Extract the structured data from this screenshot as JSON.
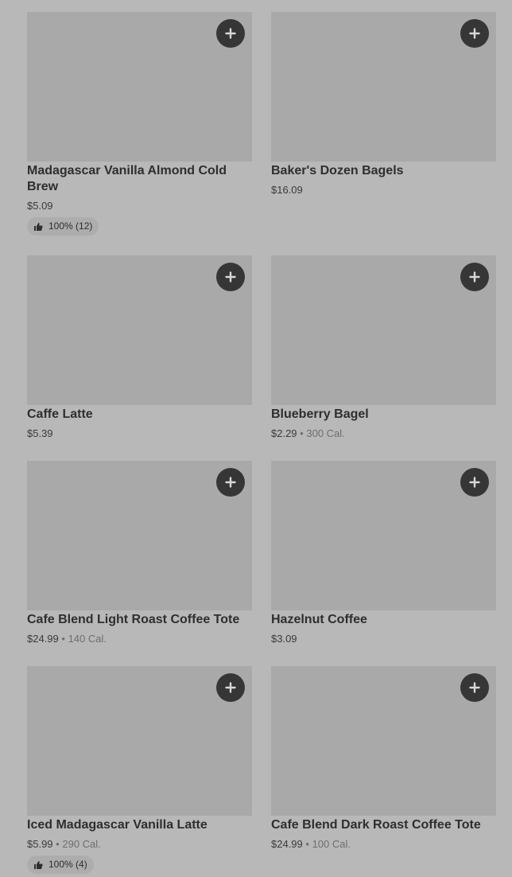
{
  "products": [
    {
      "name": "Madagascar Vanilla Almond Cold Brew",
      "price": "$5.09",
      "calories": "",
      "rating": "100% (12)"
    },
    {
      "name": "Baker's Dozen Bagels",
      "price": "$16.09",
      "calories": "",
      "rating": ""
    },
    {
      "name": "Caffe Latte",
      "price": "$5.39",
      "calories": "",
      "rating": ""
    },
    {
      "name": "Blueberry Bagel",
      "price": "$2.29",
      "calories": "300 Cal.",
      "rating": ""
    },
    {
      "name": "Cafe Blend Light Roast Coffee Tote",
      "price": "$24.99",
      "calories": "140 Cal.",
      "rating": ""
    },
    {
      "name": "Hazelnut Coffee",
      "price": "$3.09",
      "calories": "",
      "rating": ""
    },
    {
      "name": "Iced Madagascar Vanilla Latte",
      "price": "$5.99",
      "calories": "290 Cal.",
      "rating": "100% (4)"
    },
    {
      "name": "Cafe Blend Dark Roast Coffee Tote",
      "price": "$24.99",
      "calories": "100 Cal.",
      "rating": ""
    }
  ],
  "separator": "•",
  "icons": {
    "add": "plus-icon",
    "rating": "thumbs-up-icon"
  },
  "colors": {
    "background": "#b8b8b8",
    "thumbnail": "#a9a9a9",
    "add_button": "#363636"
  }
}
